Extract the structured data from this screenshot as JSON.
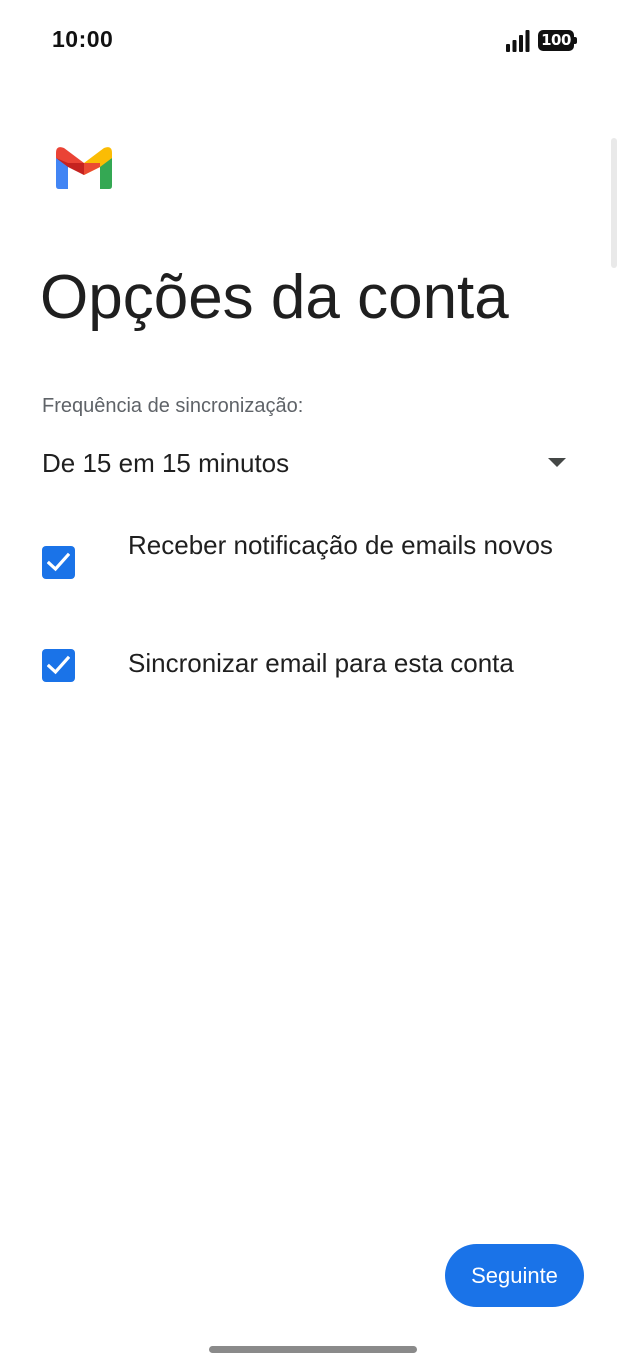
{
  "status_bar": {
    "time": "10:00",
    "battery": "100",
    "icons": [
      "signal-icon",
      "battery-icon"
    ]
  },
  "header": {
    "logo": "gmail-logo",
    "title": "Opções da conta"
  },
  "sync": {
    "label": "Frequência de sincronização:",
    "selected": "De 15 em 15 minutos"
  },
  "options": [
    {
      "label": "Receber notificação de emails novos",
      "checked": true
    },
    {
      "label": "Sincronizar email para esta conta",
      "checked": true
    }
  ],
  "footer": {
    "next_label": "Seguinte"
  },
  "colors": {
    "accent": "#1a73e8",
    "text": "#1f1f1f",
    "secondary_text": "#5f6368"
  }
}
